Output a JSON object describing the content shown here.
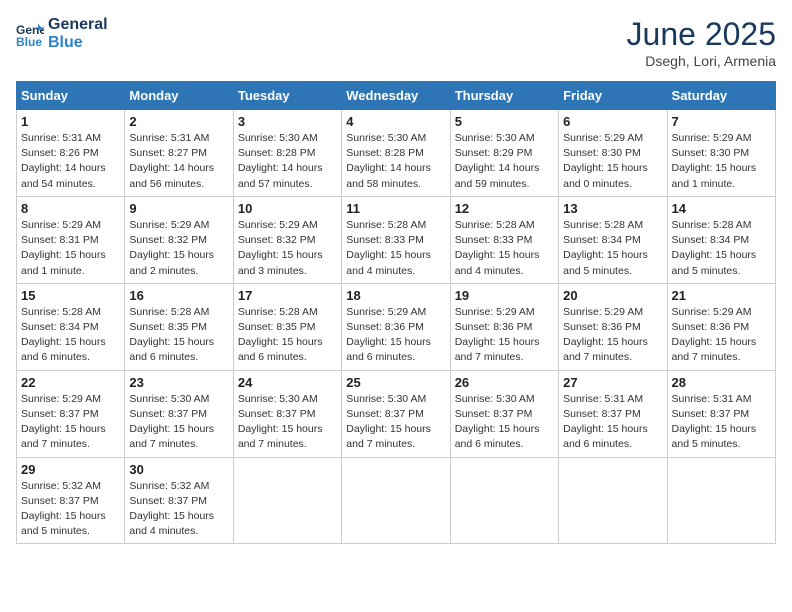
{
  "header": {
    "logo_line1": "General",
    "logo_line2": "Blue",
    "month_title": "June 2025",
    "location": "Dsegh, Lori, Armenia"
  },
  "weekdays": [
    "Sunday",
    "Monday",
    "Tuesday",
    "Wednesday",
    "Thursday",
    "Friday",
    "Saturday"
  ],
  "weeks": [
    [
      {
        "day": "1",
        "info": "Sunrise: 5:31 AM\nSunset: 8:26 PM\nDaylight: 14 hours\nand 54 minutes."
      },
      {
        "day": "2",
        "info": "Sunrise: 5:31 AM\nSunset: 8:27 PM\nDaylight: 14 hours\nand 56 minutes."
      },
      {
        "day": "3",
        "info": "Sunrise: 5:30 AM\nSunset: 8:28 PM\nDaylight: 14 hours\nand 57 minutes."
      },
      {
        "day": "4",
        "info": "Sunrise: 5:30 AM\nSunset: 8:28 PM\nDaylight: 14 hours\nand 58 minutes."
      },
      {
        "day": "5",
        "info": "Sunrise: 5:30 AM\nSunset: 8:29 PM\nDaylight: 14 hours\nand 59 minutes."
      },
      {
        "day": "6",
        "info": "Sunrise: 5:29 AM\nSunset: 8:30 PM\nDaylight: 15 hours\nand 0 minutes."
      },
      {
        "day": "7",
        "info": "Sunrise: 5:29 AM\nSunset: 8:30 PM\nDaylight: 15 hours\nand 1 minute."
      }
    ],
    [
      {
        "day": "8",
        "info": "Sunrise: 5:29 AM\nSunset: 8:31 PM\nDaylight: 15 hours\nand 1 minute."
      },
      {
        "day": "9",
        "info": "Sunrise: 5:29 AM\nSunset: 8:32 PM\nDaylight: 15 hours\nand 2 minutes."
      },
      {
        "day": "10",
        "info": "Sunrise: 5:29 AM\nSunset: 8:32 PM\nDaylight: 15 hours\nand 3 minutes."
      },
      {
        "day": "11",
        "info": "Sunrise: 5:28 AM\nSunset: 8:33 PM\nDaylight: 15 hours\nand 4 minutes."
      },
      {
        "day": "12",
        "info": "Sunrise: 5:28 AM\nSunset: 8:33 PM\nDaylight: 15 hours\nand 4 minutes."
      },
      {
        "day": "13",
        "info": "Sunrise: 5:28 AM\nSunset: 8:34 PM\nDaylight: 15 hours\nand 5 minutes."
      },
      {
        "day": "14",
        "info": "Sunrise: 5:28 AM\nSunset: 8:34 PM\nDaylight: 15 hours\nand 5 minutes."
      }
    ],
    [
      {
        "day": "15",
        "info": "Sunrise: 5:28 AM\nSunset: 8:34 PM\nDaylight: 15 hours\nand 6 minutes."
      },
      {
        "day": "16",
        "info": "Sunrise: 5:28 AM\nSunset: 8:35 PM\nDaylight: 15 hours\nand 6 minutes."
      },
      {
        "day": "17",
        "info": "Sunrise: 5:28 AM\nSunset: 8:35 PM\nDaylight: 15 hours\nand 6 minutes."
      },
      {
        "day": "18",
        "info": "Sunrise: 5:29 AM\nSunset: 8:36 PM\nDaylight: 15 hours\nand 6 minutes."
      },
      {
        "day": "19",
        "info": "Sunrise: 5:29 AM\nSunset: 8:36 PM\nDaylight: 15 hours\nand 7 minutes."
      },
      {
        "day": "20",
        "info": "Sunrise: 5:29 AM\nSunset: 8:36 PM\nDaylight: 15 hours\nand 7 minutes."
      },
      {
        "day": "21",
        "info": "Sunrise: 5:29 AM\nSunset: 8:36 PM\nDaylight: 15 hours\nand 7 minutes."
      }
    ],
    [
      {
        "day": "22",
        "info": "Sunrise: 5:29 AM\nSunset: 8:37 PM\nDaylight: 15 hours\nand 7 minutes."
      },
      {
        "day": "23",
        "info": "Sunrise: 5:30 AM\nSunset: 8:37 PM\nDaylight: 15 hours\nand 7 minutes."
      },
      {
        "day": "24",
        "info": "Sunrise: 5:30 AM\nSunset: 8:37 PM\nDaylight: 15 hours\nand 7 minutes."
      },
      {
        "day": "25",
        "info": "Sunrise: 5:30 AM\nSunset: 8:37 PM\nDaylight: 15 hours\nand 7 minutes."
      },
      {
        "day": "26",
        "info": "Sunrise: 5:30 AM\nSunset: 8:37 PM\nDaylight: 15 hours\nand 6 minutes."
      },
      {
        "day": "27",
        "info": "Sunrise: 5:31 AM\nSunset: 8:37 PM\nDaylight: 15 hours\nand 6 minutes."
      },
      {
        "day": "28",
        "info": "Sunrise: 5:31 AM\nSunset: 8:37 PM\nDaylight: 15 hours\nand 5 minutes."
      }
    ],
    [
      {
        "day": "29",
        "info": "Sunrise: 5:32 AM\nSunset: 8:37 PM\nDaylight: 15 hours\nand 5 minutes."
      },
      {
        "day": "30",
        "info": "Sunrise: 5:32 AM\nSunset: 8:37 PM\nDaylight: 15 hours\nand 4 minutes."
      },
      {
        "day": "",
        "info": ""
      },
      {
        "day": "",
        "info": ""
      },
      {
        "day": "",
        "info": ""
      },
      {
        "day": "",
        "info": ""
      },
      {
        "day": "",
        "info": ""
      }
    ]
  ]
}
